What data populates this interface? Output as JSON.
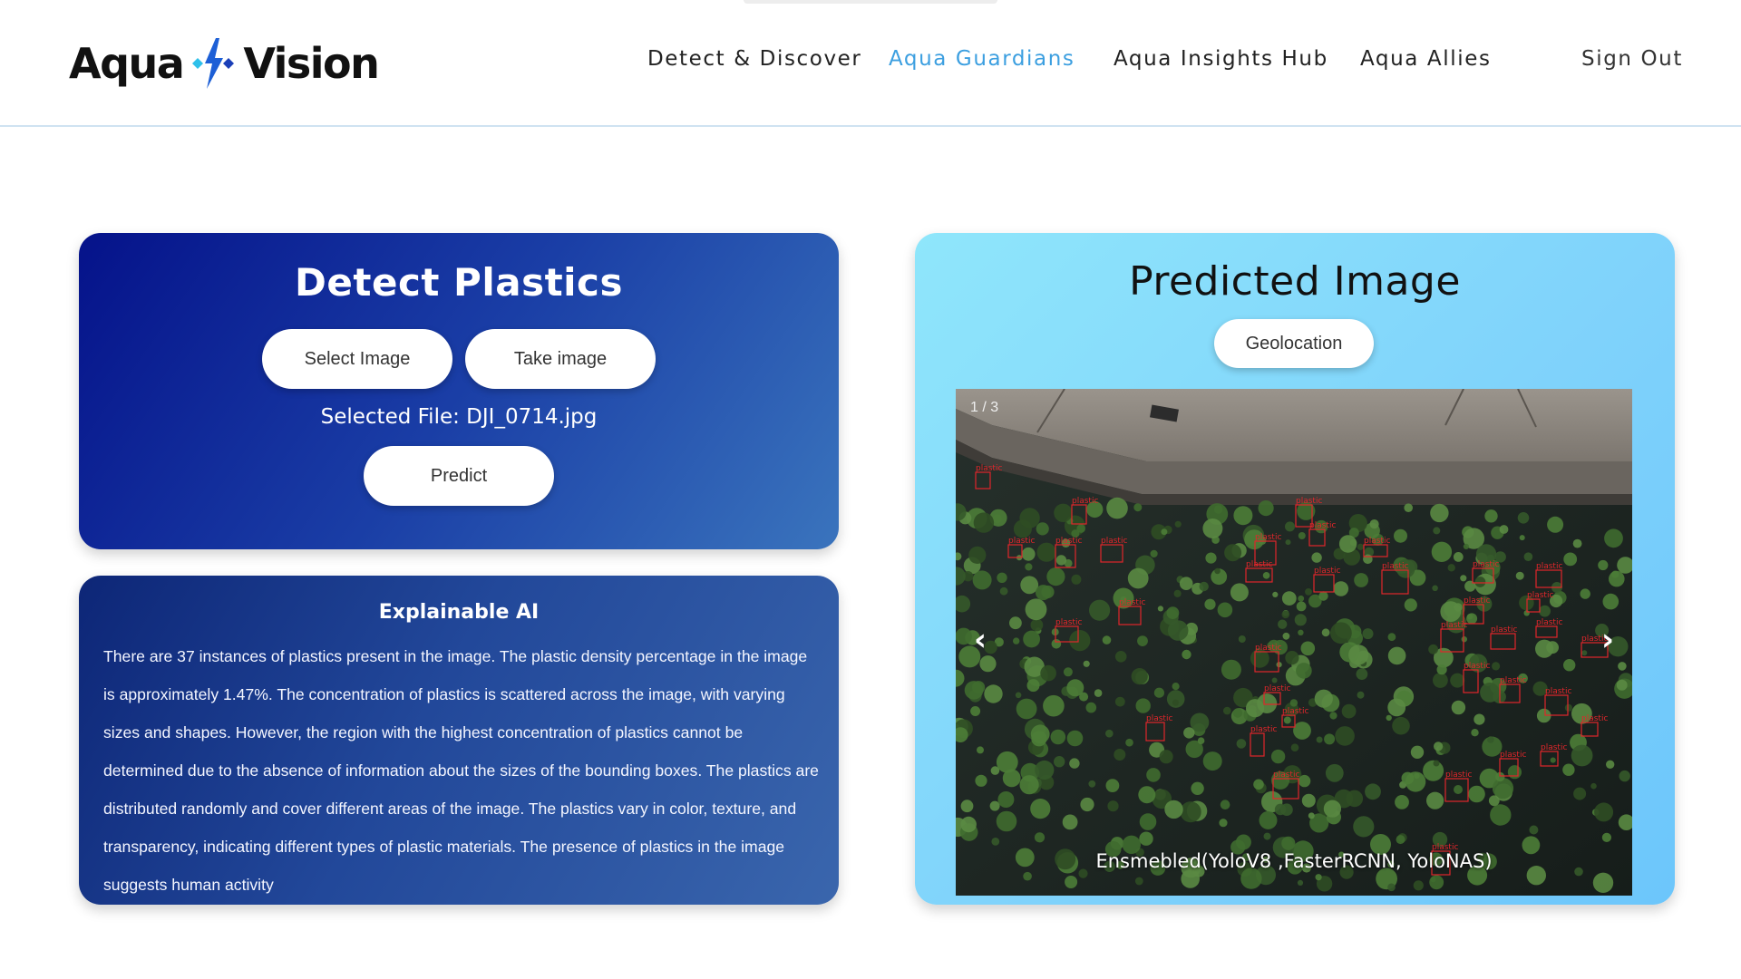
{
  "header": {
    "logo_left": "Aqua",
    "logo_right": "Vision",
    "nav": [
      {
        "label": "Detect & Discover"
      },
      {
        "label": "Aqua Guardians"
      },
      {
        "label": "Aqua Insights Hub"
      },
      {
        "label": "Aqua Allies"
      },
      {
        "label": "Sign Out"
      }
    ],
    "active_nav": "Aqua Guardians",
    "active_color": "#3c9fe0"
  },
  "detect": {
    "title": "Detect Plastics",
    "select_label": "Select Image",
    "take_label": "Take image",
    "selected_file": "Selected File: DJI_0714.jpg",
    "predict_label": "Predict"
  },
  "xai": {
    "title": "Explainable AI",
    "text": "There are 37 instances of plastics present in the image. The plastic density percentage in the image is approximately 1.47%. The concentration of plastics is scattered across the image, with varying sizes and shapes. However, the region with the highest concentration of plastics cannot be determined due to the absence of information about the sizes of the bounding boxes. The plastics are distributed randomly and cover different areas of the image. The plastics vary in color, texture, and transparency, indicating different types of plastic materials. The presence of plastics in the image suggests human activity"
  },
  "prediction": {
    "title": "Predicted Image",
    "geo_label": "Geolocation",
    "counter": "1 / 3",
    "prev_icon": "‹",
    "next_icon": "›",
    "caption": "Ensmebled(YoloV8 ,FasterRCNN, YoloNAS)",
    "detection_label": "plastic",
    "detection_color": "#e0262b"
  }
}
